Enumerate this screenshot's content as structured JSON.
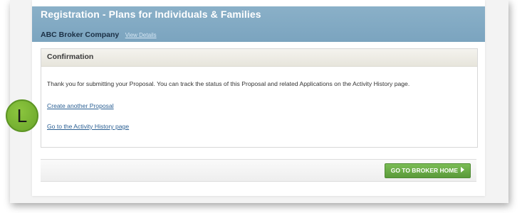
{
  "header": {
    "title": "Registration - Plans for Individuals & Families",
    "company_name": "ABC Broker Company",
    "view_details_label": "View Details"
  },
  "confirmation": {
    "title": "Confirmation",
    "message": "Thank you for submitting your Proposal. You can track the status of this Proposal and related Applications on the Activity History page.",
    "create_link": "Create another Proposal",
    "history_link": "Go to the Activity History page"
  },
  "footer": {
    "home_button_label": "GO TO BROKER HOME"
  },
  "marker": {
    "label": "L"
  },
  "colors": {
    "header_blue": "#7ba4bf",
    "button_green": "#5a9a3a",
    "link_blue": "#2a5f93",
    "marker_green": "#7ab534"
  },
  "icons": {
    "home_button_arrow": "arrow-right-icon"
  }
}
